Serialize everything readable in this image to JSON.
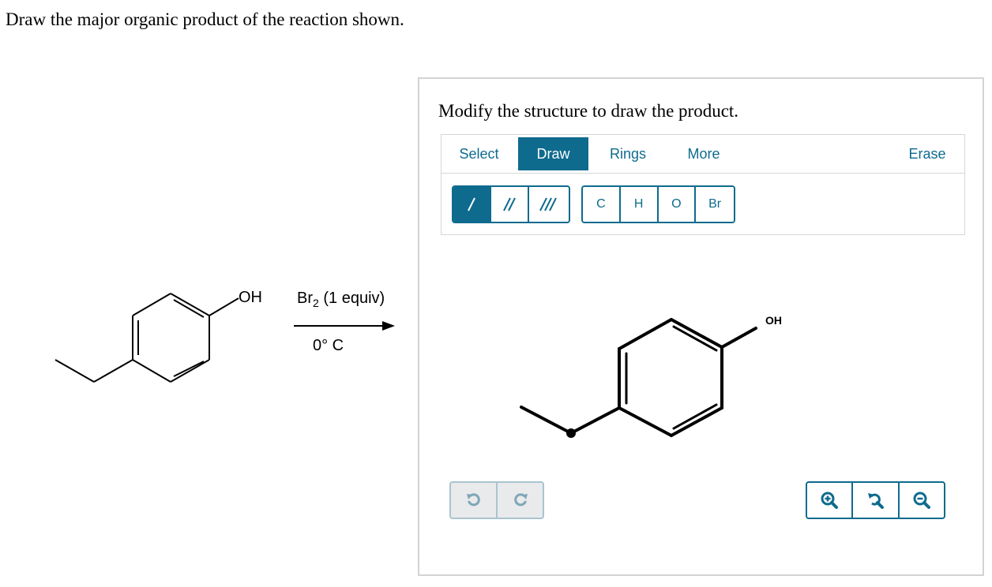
{
  "question": "Draw the major organic product of the reaction shown.",
  "reaction": {
    "reagent_main": "Br",
    "reagent_sub": "2",
    "reagent_rest": " (1 equiv)",
    "condition": "0° C",
    "substituent": "OH"
  },
  "panel": {
    "title": "Modify the structure to draw the product.",
    "tabs": [
      {
        "label": "Select",
        "active": false
      },
      {
        "label": "Draw",
        "active": true
      },
      {
        "label": "Rings",
        "active": false
      },
      {
        "label": "More",
        "active": false
      }
    ],
    "erase_label": "Erase",
    "bond_tools": [
      "single-bond",
      "double-bond",
      "triple-bond"
    ],
    "atoms": [
      "C",
      "H",
      "O",
      "Br"
    ],
    "canvas_label": "OH",
    "accent_color": "#0e6b8e"
  }
}
